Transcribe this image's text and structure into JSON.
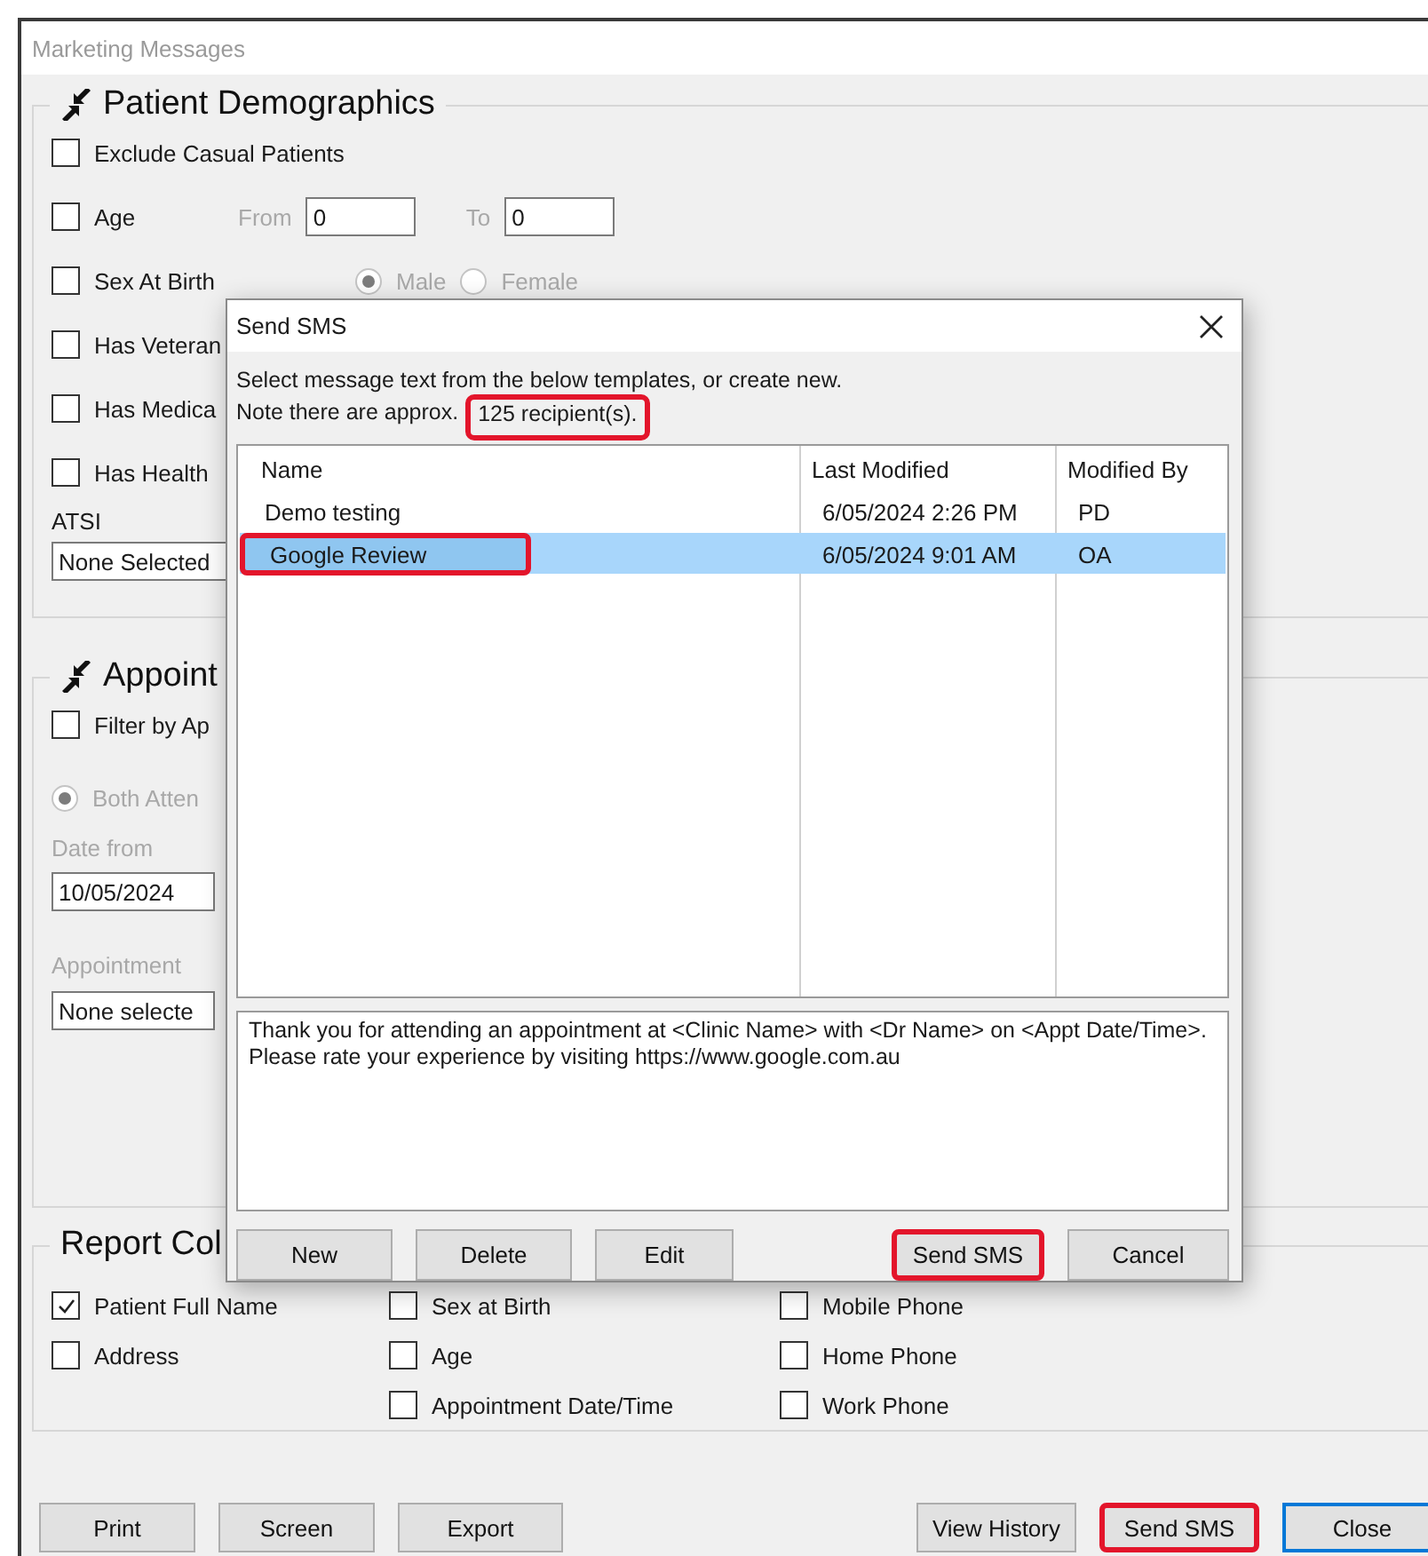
{
  "window": {
    "title": "Marketing Messages"
  },
  "patient_demographics": {
    "title": "Patient Demographics",
    "options": [
      {
        "kind": "checkbox",
        "label": "Exclude Casual Patients",
        "checked": false
      },
      {
        "kind": "range",
        "label": "Age",
        "checked": false,
        "disabled": true,
        "from_label": "From",
        "from_value": "0",
        "to_label": "To",
        "to_value": "0"
      },
      {
        "kind": "radio",
        "label": "Sex At Birth",
        "checked": false,
        "disabled": true,
        "choices": [
          {
            "label": "Male",
            "selected": true
          },
          {
            "label": "Female",
            "selected": false
          }
        ]
      },
      {
        "kind": "checkbox",
        "label": "Has Veteran",
        "checked": false
      },
      {
        "kind": "checkbox",
        "label": "Has Medica",
        "checked": false
      },
      {
        "kind": "checkbox",
        "label": "Has Health",
        "checked": false
      }
    ],
    "atsi": {
      "label": "ATSI",
      "value": "None Selected"
    }
  },
  "appointments": {
    "title": "Appoint",
    "filter": {
      "label": "Filter by Ap",
      "checked": false
    },
    "attendance": {
      "label": "Both Atten",
      "selected": true,
      "disabled": true
    },
    "date_from": {
      "label": "Date from",
      "value": "10/05/2024"
    },
    "appointment": {
      "label": "Appointment",
      "value": "None selecte"
    }
  },
  "report_columns": {
    "title": "Report Col",
    "groups": [
      {
        "items": [
          {
            "label": "Patient Full Name",
            "checked": true
          },
          {
            "label": "Address",
            "checked": false
          }
        ]
      },
      {
        "items": [
          {
            "label": "Sex at Birth",
            "checked": false
          },
          {
            "label": "Age",
            "checked": false
          },
          {
            "label": "Appointment Date/Time",
            "checked": false
          }
        ]
      },
      {
        "items": [
          {
            "label": "Mobile Phone",
            "checked": false
          },
          {
            "label": "Home Phone",
            "checked": false
          },
          {
            "label": "Work Phone",
            "checked": false
          }
        ]
      }
    ]
  },
  "buttons": {
    "left": [
      {
        "label": "Print",
        "highlighted": false,
        "default": false
      },
      {
        "label": "Screen",
        "highlighted": false,
        "default": false
      },
      {
        "label": "Export",
        "highlighted": false,
        "default": false
      }
    ],
    "right": [
      {
        "label": "View History",
        "highlighted": false,
        "default": false
      },
      {
        "label": "Send SMS",
        "highlighted": true,
        "default": false
      },
      {
        "label": "Close",
        "highlighted": false,
        "default": true
      }
    ]
  },
  "dialog": {
    "title": "Send SMS",
    "note": "Select message text from the below templates, or create new.",
    "recipients_prefix": "Note there are approx.",
    "recipients": {
      "text": "125 recipient(s).",
      "highlighted": true
    },
    "table": {
      "columns": [
        "Name",
        "Last Modified",
        "Modified By"
      ],
      "rows": [
        {
          "cells": [
            "Demo testing",
            "6/05/2024 2:26 PM",
            "PD"
          ],
          "selected": false,
          "highlighted": false
        },
        {
          "cells": [
            "Google Review",
            "6/05/2024 9:01 AM",
            "OA"
          ],
          "selected": true,
          "highlighted": true
        }
      ]
    },
    "message": "Thank you for attending an appointment at <Clinic Name> with <Dr Name> on <Appt Date/Time>.\nPlease rate your experience by visiting https://www.google.com.au",
    "buttons": {
      "left": [
        {
          "label": "New",
          "highlighted": false
        },
        {
          "label": "Delete",
          "highlighted": false
        },
        {
          "label": "Edit",
          "highlighted": false
        }
      ],
      "right": [
        {
          "label": "Send SMS",
          "highlighted": true
        },
        {
          "label": "Cancel",
          "highlighted": false
        }
      ]
    }
  }
}
